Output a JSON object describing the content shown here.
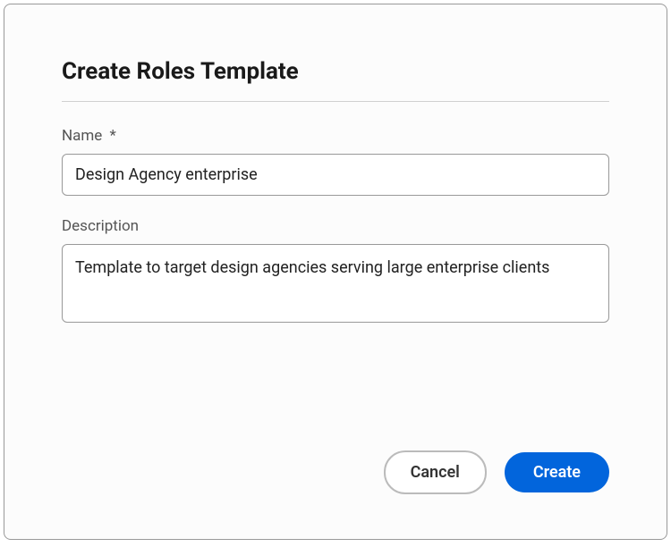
{
  "dialog": {
    "title": "Create Roles Template",
    "fields": {
      "name": {
        "label": "Name",
        "required_mark": "*",
        "value": "Design Agency enterprise"
      },
      "description": {
        "label": "Description",
        "value": "Template to target design agencies serving large enterprise clients"
      }
    },
    "buttons": {
      "cancel": "Cancel",
      "create": "Create"
    }
  }
}
